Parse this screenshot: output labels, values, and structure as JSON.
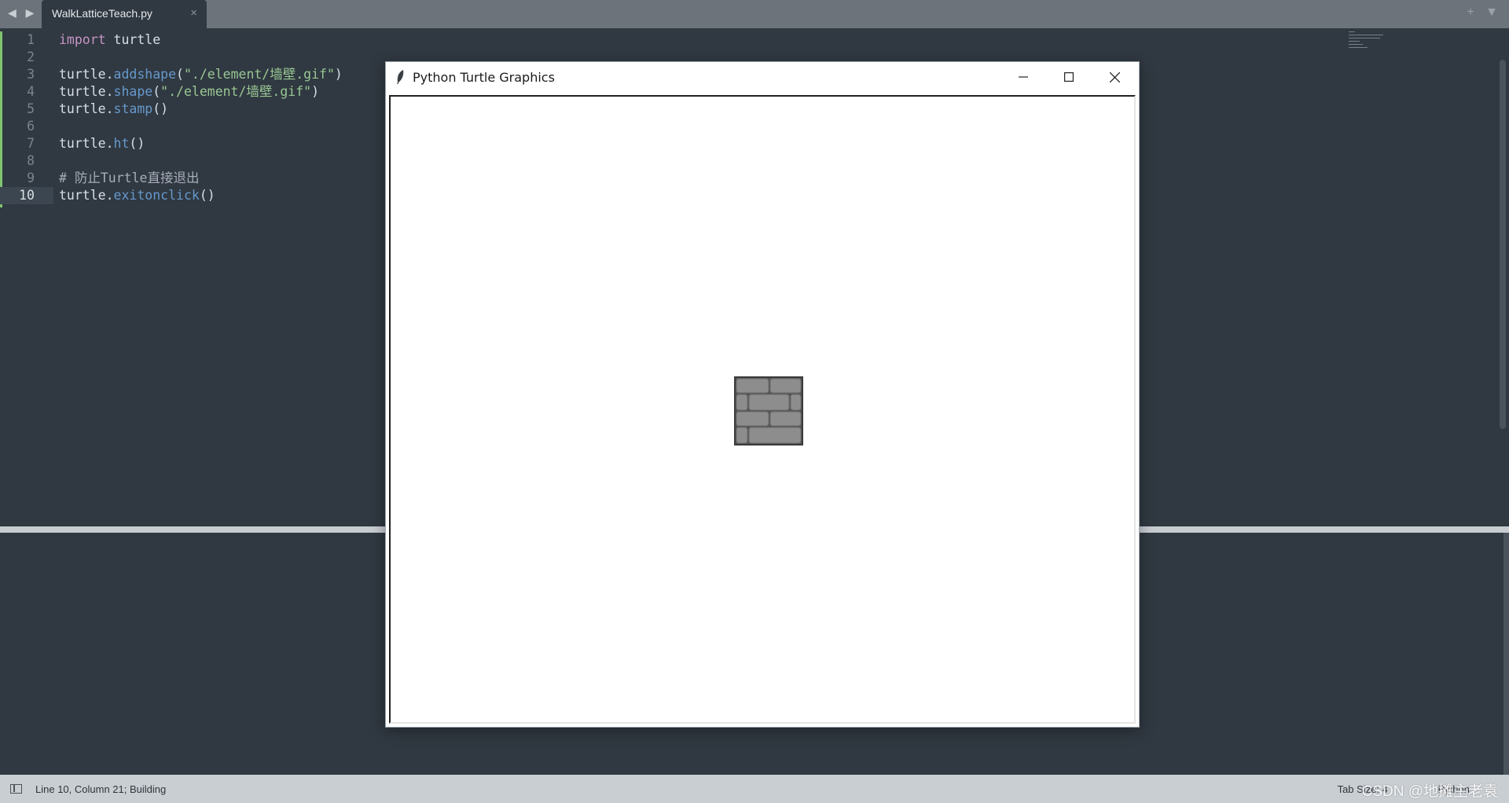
{
  "tabbar": {
    "back_arrow": "◀",
    "forward_arrow": "▶",
    "active_tab": "WalkLatticeTeach.py",
    "close_glyph": "×",
    "new_tab_glyph": "+",
    "tab_menu_glyph": "▼"
  },
  "editor": {
    "lines": [
      {
        "num": "1",
        "text": "import turtle"
      },
      {
        "num": "2",
        "text": ""
      },
      {
        "num": "3",
        "text": "turtle.addshape(\"./element/墙壁.gif\")"
      },
      {
        "num": "4",
        "text": "turtle.shape(\"./element/墙壁.gif\")"
      },
      {
        "num": "5",
        "text": "turtle.stamp()"
      },
      {
        "num": "6",
        "text": ""
      },
      {
        "num": "7",
        "text": "turtle.ht()"
      },
      {
        "num": "8",
        "text": ""
      },
      {
        "num": "9",
        "text": "# 防止Turtle直接退出"
      },
      {
        "num": "10",
        "text": "turtle.exitonclick()"
      }
    ],
    "current_line": 10,
    "colors": {
      "keyword": "#c594c5",
      "function": "#6699cc",
      "string": "#99c794",
      "comment": "#a6acb9",
      "modified_marker": "#7fc470"
    }
  },
  "turtle_window": {
    "title": "Python Turtle Graphics",
    "minimize_glyph": "—",
    "maximize_glyph": "☐",
    "close_glyph": "✕",
    "stamp_shape": "wall-brick-tile"
  },
  "statusbar": {
    "position_text": "Line 10, Column 21; Building",
    "tab_size": "Tab Size: 4",
    "syntax": "Python",
    "watermark": "CSDN @地摊主老袁"
  }
}
